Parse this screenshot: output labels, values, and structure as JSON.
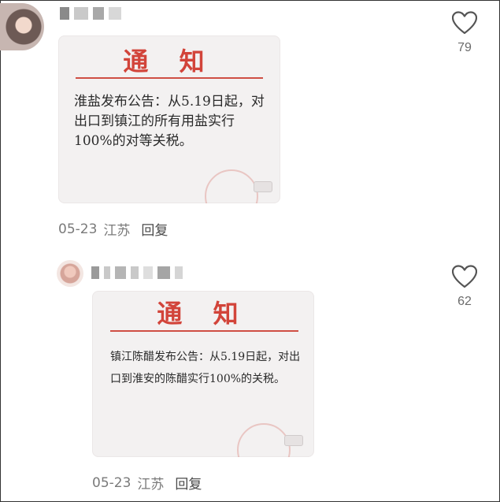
{
  "comments": [
    {
      "like_count": "79",
      "notice": {
        "title": "通 知",
        "body": "淮盐发布公告：从5.19日起，对出口到镇江的所有用盐实行100%的对等关税。"
      },
      "date": "05-23",
      "location": "江苏",
      "reply_label": "回复"
    },
    {
      "like_count": "62",
      "notice": {
        "title": "通 知",
        "body": "镇江陈醋发布公告：从5.19日起，对出口到淮安的陈醋实行100%的关税。"
      },
      "date": "05-23",
      "location": "江苏",
      "reply_label": "回复"
    }
  ],
  "icons": {
    "like": "heart-outline-icon"
  },
  "colors": {
    "notice_red": "#d2443a",
    "meta_gray": "#7a7a7a"
  }
}
